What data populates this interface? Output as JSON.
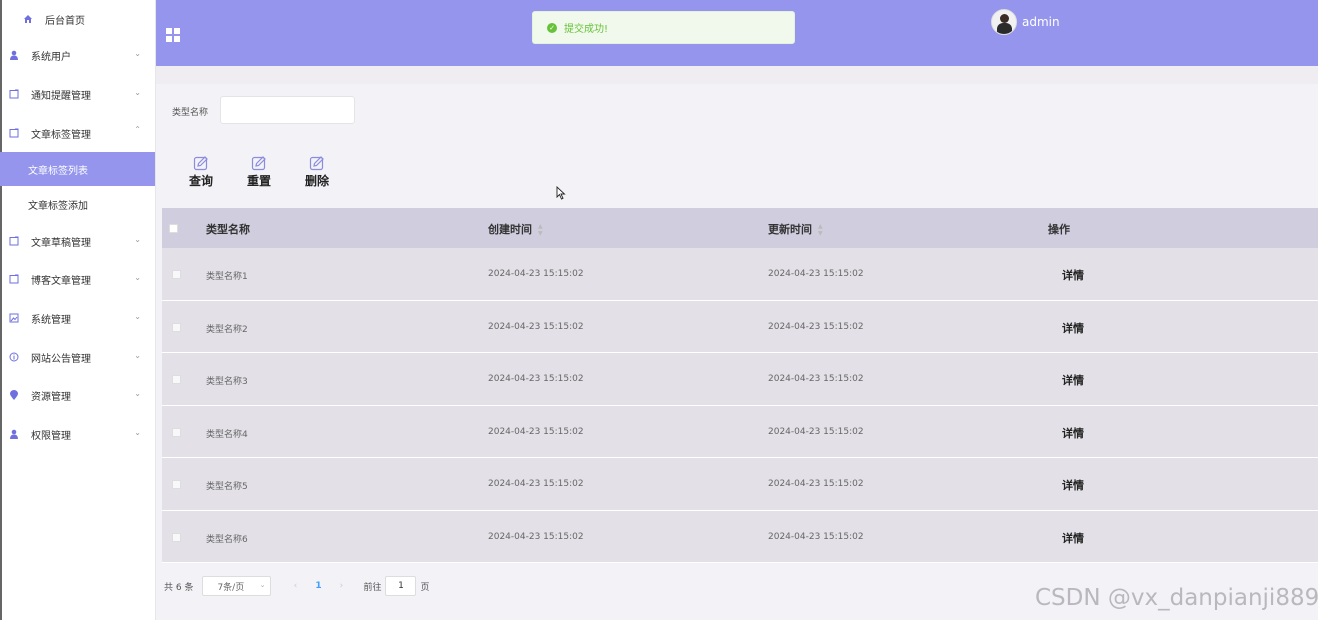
{
  "sidebar": {
    "home": "后台首页",
    "items": [
      {
        "label": "系统用户",
        "icon": "user-icon"
      },
      {
        "label": "通知提醒管理",
        "icon": "document-icon"
      },
      {
        "label": "文章标签管理",
        "icon": "document-icon",
        "expanded": true
      },
      {
        "label": "文章草稿管理",
        "icon": "document-icon"
      },
      {
        "label": "博客文章管理",
        "icon": "document-icon"
      },
      {
        "label": "系统管理",
        "icon": "picture-icon"
      },
      {
        "label": "网站公告管理",
        "icon": "info-icon"
      },
      {
        "label": "资源管理",
        "icon": "location-icon"
      },
      {
        "label": "权限管理",
        "icon": "user-icon"
      }
    ],
    "subitems": [
      "文章标签列表",
      "文章标签添加"
    ],
    "active_subitem": "文章标签列表"
  },
  "header": {
    "toast": "提交成功!",
    "username": "admin",
    "accent_color": "#9595ee"
  },
  "search": {
    "label": "类型名称",
    "value": ""
  },
  "actions": [
    "查询",
    "重置",
    "删除"
  ],
  "table": {
    "columns": [
      "类型名称",
      "创建时间",
      "更新时间",
      "操作"
    ],
    "rows": [
      {
        "name": "类型名称1",
        "created": "2024-04-23 15:15:02",
        "updated": "2024-04-23 15:15:02",
        "action": "详情"
      },
      {
        "name": "类型名称2",
        "created": "2024-04-23 15:15:02",
        "updated": "2024-04-23 15:15:02",
        "action": "详情"
      },
      {
        "name": "类型名称3",
        "created": "2024-04-23 15:15:02",
        "updated": "2024-04-23 15:15:02",
        "action": "详情"
      },
      {
        "name": "类型名称4",
        "created": "2024-04-23 15:15:02",
        "updated": "2024-04-23 15:15:02",
        "action": "详情"
      },
      {
        "name": "类型名称5",
        "created": "2024-04-23 15:15:02",
        "updated": "2024-04-23 15:15:02",
        "action": "详情"
      },
      {
        "name": "类型名称6",
        "created": "2024-04-23 15:15:02",
        "updated": "2024-04-23 15:15:02",
        "action": "详情"
      }
    ]
  },
  "pagination": {
    "total": "共 6 条",
    "page_size": "7条/页",
    "current_page": "1",
    "goto_label": "前往",
    "goto_value": "1",
    "page_unit": "页"
  },
  "watermark": "CSDN @vx_danpianji889"
}
